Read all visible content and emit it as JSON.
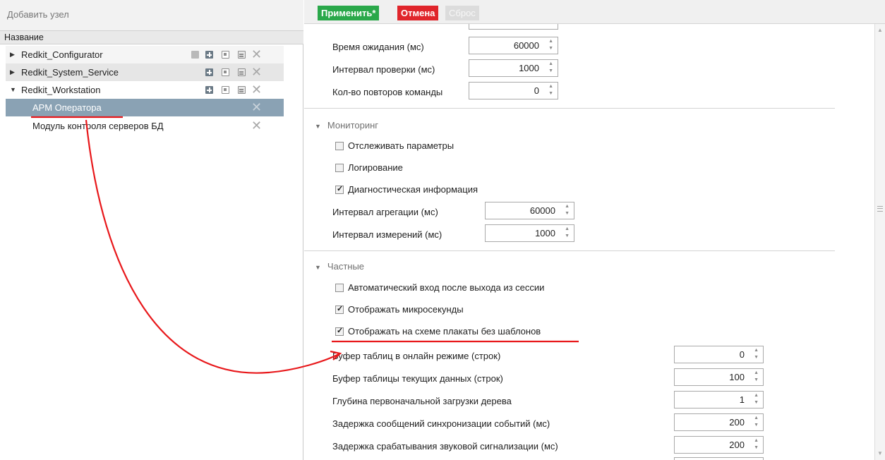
{
  "left_pane": {
    "add_node_label": "Добавить узел",
    "tree_header": "Название",
    "tree_items": [
      {
        "label": "Redkit_Configurator",
        "caret": "▶"
      },
      {
        "label": "Redkit_System_Service",
        "caret": "▶"
      },
      {
        "label": "Redkit_Workstation",
        "caret": "▼"
      },
      {
        "label": "АРМ Оператора"
      },
      {
        "label": "Модуль контроля серверов БД"
      }
    ]
  },
  "toolbar": {
    "apply_label": "Применить*",
    "cancel_label": "Отмена",
    "reset_label": "Сброс"
  },
  "settings": {
    "top_fields": [
      {
        "label": "Время ожидания (мс)",
        "value": "60000"
      },
      {
        "label": "Интервал проверки (мс)",
        "value": "1000"
      },
      {
        "label": "Кол-во повторов команды",
        "value": "0"
      }
    ],
    "monitoring": {
      "title": "Мониторинг",
      "checkboxes": [
        {
          "label": "Отслеживать параметры",
          "checked": false
        },
        {
          "label": "Логирование",
          "checked": false
        },
        {
          "label": "Диагностическая информация",
          "checked": true
        }
      ],
      "fields": [
        {
          "label": "Интервал агрегации (мс)",
          "value": "60000"
        },
        {
          "label": "Интервал измерений (мс)",
          "value": "1000"
        }
      ]
    },
    "private": {
      "title": "Частные",
      "checkboxes": [
        {
          "label": "Автоматический вход после выхода из сессии",
          "checked": false
        },
        {
          "label": "Отображать микросекунды",
          "checked": true
        },
        {
          "label": "Отображать на схеме плакаты без шаблонов",
          "checked": true
        }
      ],
      "fields": [
        {
          "label": "Буфер таблиц в онлайн режиме (строк)",
          "value": "0"
        },
        {
          "label": "Буфер таблицы текущих данных (строк)",
          "value": "100"
        },
        {
          "label": "Глубина первоначальной загрузки дерева",
          "value": "1"
        },
        {
          "label": "Задержка сообщений синхронизации событий (мс)",
          "value": "200"
        },
        {
          "label": "Задержка срабатывания звуковой сигнализации (мс)",
          "value": "200"
        }
      ]
    }
  },
  "colors": {
    "apply": "#2aa84a",
    "cancel": "#e0252b",
    "selected_row": "#8aa2b4",
    "annotation": "#e8181b"
  }
}
